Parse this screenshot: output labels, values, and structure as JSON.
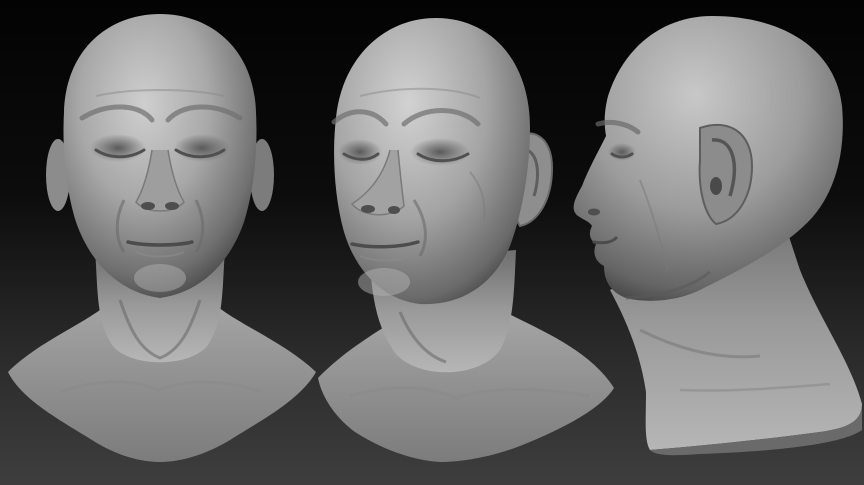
{
  "scene": {
    "subject": "three-views-of-sculpted-head",
    "views": [
      "front",
      "three-quarter",
      "profile"
    ],
    "colors": {
      "background_top": "#030303",
      "background_bottom": "#3e3e3e",
      "clay_light": "#c9c9c9",
      "clay_mid": "#9a9a9a",
      "clay_dark": "#4a4a4a"
    }
  }
}
